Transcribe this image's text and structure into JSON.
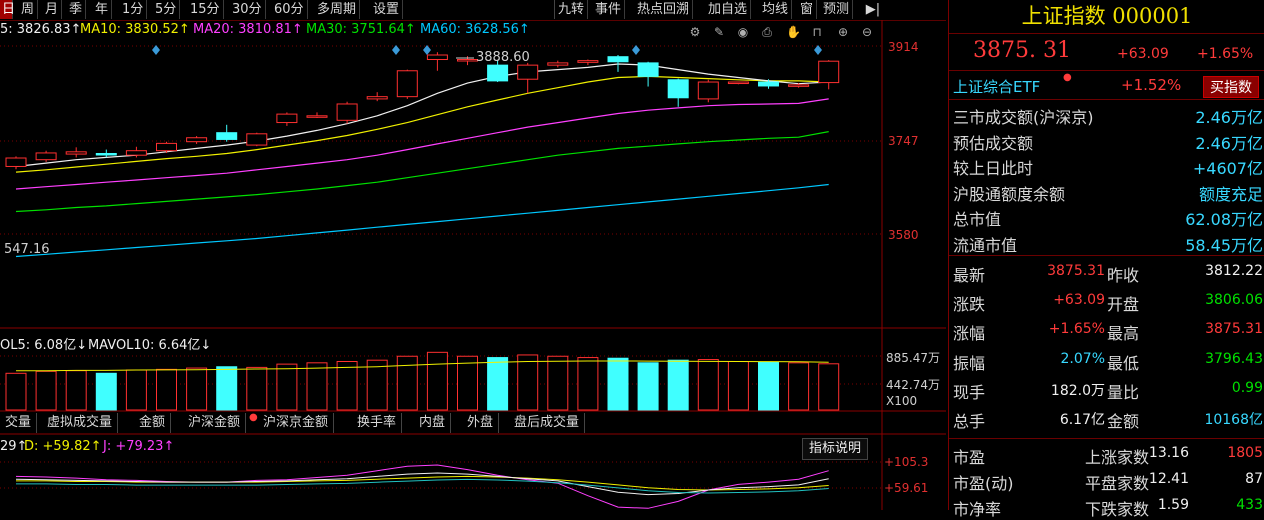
{
  "toolbar": {
    "left_items": [
      "日",
      "周",
      "月",
      "季",
      "年",
      "1分",
      "5分",
      "15分",
      "30分",
      "60分",
      "多周期",
      "设置"
    ],
    "right_items": [
      "九转",
      "事件",
      "热点回溯",
      "加自选",
      "均线",
      "窗",
      "预测"
    ],
    "expand_icon": "play-end-icon"
  },
  "ma_legend": {
    "ma5": "5: 3826.83↑",
    "ma10": "MA10: 3830.52↑",
    "ma20": "MA20: 3810.81↑",
    "ma30": "MA30: 3751.64↑",
    "ma60": "MA60: 3628.56↑",
    "colors": {
      "ma5": "#f0f0f0",
      "ma10": "#f0f000",
      "ma20": "#ff40ff",
      "ma30": "#00e000",
      "ma60": "#00c8ff"
    }
  },
  "chart_icons": [
    "settings-icon",
    "draw-icon",
    "eye-icon",
    "print-icon",
    "hand-icon",
    "lock-icon",
    "zoom-in-icon",
    "zoom-out-icon"
  ],
  "price_axis": {
    "high": "3914",
    "mid": "3747",
    "low": "3580"
  },
  "annotations": {
    "peak": "3888.60",
    "left_low": "547.16"
  },
  "volume_legend": {
    "vol5": "OL5: 6.08亿↓",
    "mavol10": "MAVOL10: 6.64亿↓"
  },
  "volume_axis": {
    "top": "885.47万",
    "mid": "442.74万",
    "unit": "X100"
  },
  "bottom_tabs": [
    "交量",
    "虚拟成交量",
    "金额",
    "沪深金额",
    "沪深京金额",
    "换手率",
    "内盘",
    "外盘",
    "盘后成交量"
  ],
  "kdj_legend": {
    "k": "29↑",
    "d": "D: +59.82↑",
    "j": "J: +79.23↑"
  },
  "indicator_button": "指标说明",
  "kdj_axis": {
    "top": "+105.3",
    "mid": "+59.61"
  },
  "chart_data": {
    "type": "candlestick",
    "candles": [
      {
        "o": 3700,
        "c": 3715,
        "h": 3718,
        "l": 3695
      },
      {
        "o": 3712,
        "c": 3724,
        "h": 3728,
        "l": 3708
      },
      {
        "o": 3722,
        "c": 3726,
        "h": 3734,
        "l": 3716
      },
      {
        "o": 3723,
        "c": 3722,
        "h": 3730,
        "l": 3716
      },
      {
        "o": 3720,
        "c": 3728,
        "h": 3735,
        "l": 3716
      },
      {
        "o": 3728,
        "c": 3741,
        "h": 3744,
        "l": 3724
      },
      {
        "o": 3744,
        "c": 3751,
        "h": 3754,
        "l": 3740
      },
      {
        "o": 3760,
        "c": 3748,
        "h": 3774,
        "l": 3744
      },
      {
        "o": 3738,
        "c": 3758,
        "h": 3760,
        "l": 3736
      },
      {
        "o": 3778,
        "c": 3793,
        "h": 3796,
        "l": 3772
      },
      {
        "o": 3790,
        "c": 3790,
        "h": 3796,
        "l": 3786
      },
      {
        "o": 3782,
        "c": 3811,
        "h": 3815,
        "l": 3776
      },
      {
        "o": 3820,
        "c": 3824,
        "h": 3832,
        "l": 3816
      },
      {
        "o": 3824,
        "c": 3870,
        "h": 3872,
        "l": 3820
      },
      {
        "o": 3890,
        "c": 3898,
        "h": 3903,
        "l": 3870
      },
      {
        "o": 3890,
        "c": 3890,
        "h": 3896,
        "l": 3880
      },
      {
        "o": 3880,
        "c": 3852,
        "h": 3888,
        "l": 3850
      },
      {
        "o": 3855,
        "c": 3880,
        "h": 3884,
        "l": 3830
      },
      {
        "o": 3880,
        "c": 3884,
        "h": 3888,
        "l": 3876
      },
      {
        "o": 3885,
        "c": 3888,
        "h": 3890,
        "l": 3880
      },
      {
        "o": 3895,
        "c": 3886,
        "h": 3898,
        "l": 3868
      },
      {
        "o": 3884,
        "c": 3860,
        "h": 3886,
        "l": 3842
      },
      {
        "o": 3854,
        "c": 3822,
        "h": 3856,
        "l": 3806
      },
      {
        "o": 3820,
        "c": 3850,
        "h": 3854,
        "l": 3814
      },
      {
        "o": 3848,
        "c": 3850,
        "h": 3850,
        "l": 3846
      },
      {
        "o": 3850,
        "c": 3843,
        "h": 3855,
        "l": 3838
      },
      {
        "o": 3843,
        "c": 3845,
        "h": 3848,
        "l": 3840
      },
      {
        "o": 3849,
        "c": 3887,
        "h": 3889,
        "l": 3837
      }
    ],
    "ma5": [
      3700,
      3706,
      3712,
      3716,
      3720,
      3726,
      3732,
      3738,
      3745,
      3754,
      3764,
      3776,
      3790,
      3808,
      3830,
      3848,
      3860,
      3868,
      3872,
      3876,
      3882,
      3880,
      3872,
      3864,
      3858,
      3852,
      3847,
      3850
    ],
    "ma10": [
      3690,
      3694,
      3699,
      3704,
      3709,
      3714,
      3718,
      3723,
      3730,
      3738,
      3746,
      3755,
      3766,
      3778,
      3792,
      3806,
      3818,
      3830,
      3840,
      3850,
      3858,
      3860,
      3858,
      3856,
      3854,
      3852,
      3852,
      3850
    ],
    "ma20": [
      3660,
      3664,
      3668,
      3672,
      3676,
      3680,
      3684,
      3688,
      3694,
      3700,
      3706,
      3712,
      3720,
      3730,
      3740,
      3750,
      3760,
      3770,
      3778,
      3786,
      3794,
      3800,
      3804,
      3808,
      3810,
      3811,
      3812,
      3820
    ],
    "ma30": [
      3620,
      3623,
      3627,
      3630,
      3634,
      3638,
      3642,
      3646,
      3650,
      3655,
      3660,
      3666,
      3672,
      3680,
      3688,
      3696,
      3704,
      3712,
      3720,
      3726,
      3732,
      3736,
      3740,
      3744,
      3747,
      3750,
      3752,
      3762
    ],
    "ma60": [
      3540,
      3544,
      3548,
      3552,
      3556,
      3560,
      3564,
      3568,
      3572,
      3577,
      3582,
      3587,
      3592,
      3597,
      3602,
      3607,
      3612,
      3617,
      3622,
      3627,
      3632,
      3637,
      3642,
      3647,
      3652,
      3657,
      3662,
      3668
    ],
    "volume": [
      560,
      590,
      600,
      560,
      610,
      620,
      640,
      660,
      650,
      700,
      720,
      740,
      760,
      820,
      880,
      820,
      800,
      840,
      820,
      800,
      790,
      720,
      760,
      770,
      740,
      730,
      720,
      705
    ],
    "mavol": [
      600,
      600,
      605,
      605,
      610,
      612,
      615,
      620,
      625,
      630,
      640,
      650,
      660,
      680,
      700,
      715,
      730,
      740,
      745,
      748,
      748,
      746,
      744,
      742,
      740,
      738,
      735,
      730
    ],
    "kdj_k": [
      75,
      74,
      73,
      72,
      71,
      70,
      70,
      70,
      71,
      72,
      74,
      76,
      80,
      84,
      86,
      84,
      80,
      76,
      72,
      62,
      52,
      48,
      50,
      56,
      60,
      62,
      65,
      76
    ],
    "kdj_d": [
      72,
      72,
      71,
      71,
      70,
      70,
      70,
      70,
      70,
      71,
      72,
      73,
      75,
      77,
      79,
      80,
      79,
      77,
      74,
      70,
      65,
      60,
      57,
      56,
      57,
      58,
      60,
      64
    ],
    "kdj_j": [
      80,
      79,
      77,
      74,
      73,
      71,
      70,
      70,
      73,
      74,
      78,
      82,
      90,
      98,
      100,
      92,
      82,
      74,
      68,
      46,
      26,
      24,
      36,
      56,
      66,
      70,
      75,
      90
    ]
  },
  "right_panel": {
    "title": "上证指数 000001",
    "price": "3875. 31",
    "change": "+63.09",
    "change_pct": "+1.65%",
    "etf_name": "上证综合ETF",
    "etf_pct": "+1.52%",
    "buy_button": "买指数",
    "stats": [
      {
        "label": "三市成交额(沪深京)",
        "value": "2.46万亿"
      },
      {
        "label": "预估成交额",
        "value": "2.46万亿"
      },
      {
        "label": "较上日此时",
        "value": "+4607亿"
      },
      {
        "label": "沪股通额度余额",
        "value": "额度充足"
      },
      {
        "label": "总市值",
        "value": "62.08万亿"
      },
      {
        "label": "流通市值",
        "value": "58.45万亿"
      }
    ],
    "quote": [
      {
        "l1": "最新",
        "v1": "3875.31",
        "l2": "昨收",
        "v2": "3812.22"
      },
      {
        "l1": "涨跌",
        "v1": "+63.09",
        "l2": "开盘",
        "v2": "3806.06"
      },
      {
        "l1": "涨幅",
        "v1": "+1.65%",
        "l2": "最高",
        "v2": "3875.31"
      },
      {
        "l1": "振幅",
        "v1": "2.07%",
        "l2": "最低",
        "v2": "3796.43"
      },
      {
        "l1": "现手",
        "v1": "182.0万",
        "l2": "量比",
        "v2": "0.99"
      },
      {
        "l1": "总手",
        "v1": "6.17亿",
        "l2": "金额",
        "v2": "10168亿"
      }
    ],
    "market": [
      {
        "l1": "市盈",
        "v1": "13.16",
        "l2": "上涨家数",
        "v2": "1805"
      },
      {
        "l1": "市盈(动)",
        "v1": "12.41",
        "l2": "平盘家数",
        "v2": "87"
      },
      {
        "l1": "市净率",
        "v1": "1.59",
        "l2": "下跌家数",
        "v2": "433"
      }
    ]
  }
}
